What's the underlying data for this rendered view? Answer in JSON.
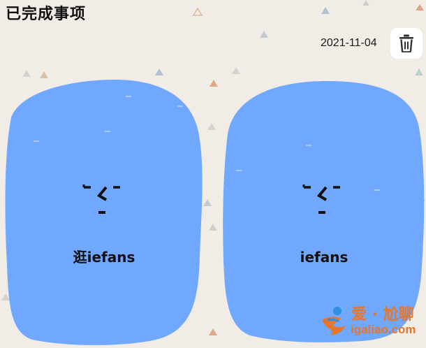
{
  "header": {
    "title": "已完成事项",
    "date": "2021-11-04",
    "delete_icon": "trash-icon"
  },
  "cards": [
    {
      "label": "逛iefans",
      "face_icon": "kaomoji-face",
      "color": "#70a7ff"
    },
    {
      "label": "iefans",
      "face_icon": "kaomoji-face",
      "color": "#70a7ff"
    }
  ],
  "watermark": {
    "text_top": "爱 · 尬聊",
    "text_bottom": "igaliao.com",
    "color": "#e5762a"
  },
  "colors": {
    "background": "#f1ede6",
    "card": "#70a7ff",
    "accent": "#e5762a"
  }
}
